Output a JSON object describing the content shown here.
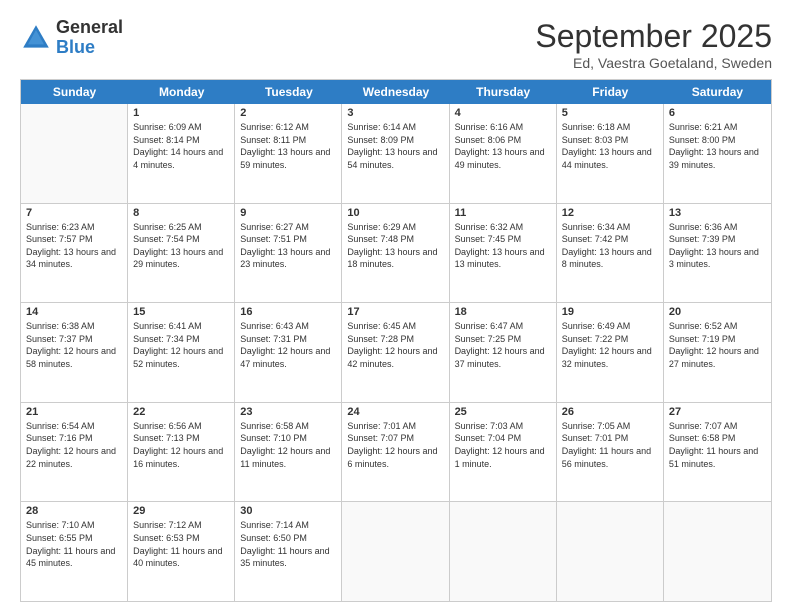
{
  "header": {
    "logo": {
      "general": "General",
      "blue": "Blue"
    },
    "title": "September 2025",
    "subtitle": "Ed, Vaestra Goetaland, Sweden"
  },
  "weekdays": [
    "Sunday",
    "Monday",
    "Tuesday",
    "Wednesday",
    "Thursday",
    "Friday",
    "Saturday"
  ],
  "weeks": [
    [
      {
        "day": "",
        "empty": true
      },
      {
        "day": "1",
        "sunrise": "Sunrise: 6:09 AM",
        "sunset": "Sunset: 8:14 PM",
        "daylight": "Daylight: 14 hours and 4 minutes."
      },
      {
        "day": "2",
        "sunrise": "Sunrise: 6:12 AM",
        "sunset": "Sunset: 8:11 PM",
        "daylight": "Daylight: 13 hours and 59 minutes."
      },
      {
        "day": "3",
        "sunrise": "Sunrise: 6:14 AM",
        "sunset": "Sunset: 8:09 PM",
        "daylight": "Daylight: 13 hours and 54 minutes."
      },
      {
        "day": "4",
        "sunrise": "Sunrise: 6:16 AM",
        "sunset": "Sunset: 8:06 PM",
        "daylight": "Daylight: 13 hours and 49 minutes."
      },
      {
        "day": "5",
        "sunrise": "Sunrise: 6:18 AM",
        "sunset": "Sunset: 8:03 PM",
        "daylight": "Daylight: 13 hours and 44 minutes."
      },
      {
        "day": "6",
        "sunrise": "Sunrise: 6:21 AM",
        "sunset": "Sunset: 8:00 PM",
        "daylight": "Daylight: 13 hours and 39 minutes."
      }
    ],
    [
      {
        "day": "7",
        "sunrise": "Sunrise: 6:23 AM",
        "sunset": "Sunset: 7:57 PM",
        "daylight": "Daylight: 13 hours and 34 minutes."
      },
      {
        "day": "8",
        "sunrise": "Sunrise: 6:25 AM",
        "sunset": "Sunset: 7:54 PM",
        "daylight": "Daylight: 13 hours and 29 minutes."
      },
      {
        "day": "9",
        "sunrise": "Sunrise: 6:27 AM",
        "sunset": "Sunset: 7:51 PM",
        "daylight": "Daylight: 13 hours and 23 minutes."
      },
      {
        "day": "10",
        "sunrise": "Sunrise: 6:29 AM",
        "sunset": "Sunset: 7:48 PM",
        "daylight": "Daylight: 13 hours and 18 minutes."
      },
      {
        "day": "11",
        "sunrise": "Sunrise: 6:32 AM",
        "sunset": "Sunset: 7:45 PM",
        "daylight": "Daylight: 13 hours and 13 minutes."
      },
      {
        "day": "12",
        "sunrise": "Sunrise: 6:34 AM",
        "sunset": "Sunset: 7:42 PM",
        "daylight": "Daylight: 13 hours and 8 minutes."
      },
      {
        "day": "13",
        "sunrise": "Sunrise: 6:36 AM",
        "sunset": "Sunset: 7:39 PM",
        "daylight": "Daylight: 13 hours and 3 minutes."
      }
    ],
    [
      {
        "day": "14",
        "sunrise": "Sunrise: 6:38 AM",
        "sunset": "Sunset: 7:37 PM",
        "daylight": "Daylight: 12 hours and 58 minutes."
      },
      {
        "day": "15",
        "sunrise": "Sunrise: 6:41 AM",
        "sunset": "Sunset: 7:34 PM",
        "daylight": "Daylight: 12 hours and 52 minutes."
      },
      {
        "day": "16",
        "sunrise": "Sunrise: 6:43 AM",
        "sunset": "Sunset: 7:31 PM",
        "daylight": "Daylight: 12 hours and 47 minutes."
      },
      {
        "day": "17",
        "sunrise": "Sunrise: 6:45 AM",
        "sunset": "Sunset: 7:28 PM",
        "daylight": "Daylight: 12 hours and 42 minutes."
      },
      {
        "day": "18",
        "sunrise": "Sunrise: 6:47 AM",
        "sunset": "Sunset: 7:25 PM",
        "daylight": "Daylight: 12 hours and 37 minutes."
      },
      {
        "day": "19",
        "sunrise": "Sunrise: 6:49 AM",
        "sunset": "Sunset: 7:22 PM",
        "daylight": "Daylight: 12 hours and 32 minutes."
      },
      {
        "day": "20",
        "sunrise": "Sunrise: 6:52 AM",
        "sunset": "Sunset: 7:19 PM",
        "daylight": "Daylight: 12 hours and 27 minutes."
      }
    ],
    [
      {
        "day": "21",
        "sunrise": "Sunrise: 6:54 AM",
        "sunset": "Sunset: 7:16 PM",
        "daylight": "Daylight: 12 hours and 22 minutes."
      },
      {
        "day": "22",
        "sunrise": "Sunrise: 6:56 AM",
        "sunset": "Sunset: 7:13 PM",
        "daylight": "Daylight: 12 hours and 16 minutes."
      },
      {
        "day": "23",
        "sunrise": "Sunrise: 6:58 AM",
        "sunset": "Sunset: 7:10 PM",
        "daylight": "Daylight: 12 hours and 11 minutes."
      },
      {
        "day": "24",
        "sunrise": "Sunrise: 7:01 AM",
        "sunset": "Sunset: 7:07 PM",
        "daylight": "Daylight: 12 hours and 6 minutes."
      },
      {
        "day": "25",
        "sunrise": "Sunrise: 7:03 AM",
        "sunset": "Sunset: 7:04 PM",
        "daylight": "Daylight: 12 hours and 1 minute."
      },
      {
        "day": "26",
        "sunrise": "Sunrise: 7:05 AM",
        "sunset": "Sunset: 7:01 PM",
        "daylight": "Daylight: 11 hours and 56 minutes."
      },
      {
        "day": "27",
        "sunrise": "Sunrise: 7:07 AM",
        "sunset": "Sunset: 6:58 PM",
        "daylight": "Daylight: 11 hours and 51 minutes."
      }
    ],
    [
      {
        "day": "28",
        "sunrise": "Sunrise: 7:10 AM",
        "sunset": "Sunset: 6:55 PM",
        "daylight": "Daylight: 11 hours and 45 minutes."
      },
      {
        "day": "29",
        "sunrise": "Sunrise: 7:12 AM",
        "sunset": "Sunset: 6:53 PM",
        "daylight": "Daylight: 11 hours and 40 minutes."
      },
      {
        "day": "30",
        "sunrise": "Sunrise: 7:14 AM",
        "sunset": "Sunset: 6:50 PM",
        "daylight": "Daylight: 11 hours and 35 minutes."
      },
      {
        "day": "",
        "empty": true
      },
      {
        "day": "",
        "empty": true
      },
      {
        "day": "",
        "empty": true
      },
      {
        "day": "",
        "empty": true
      }
    ]
  ]
}
